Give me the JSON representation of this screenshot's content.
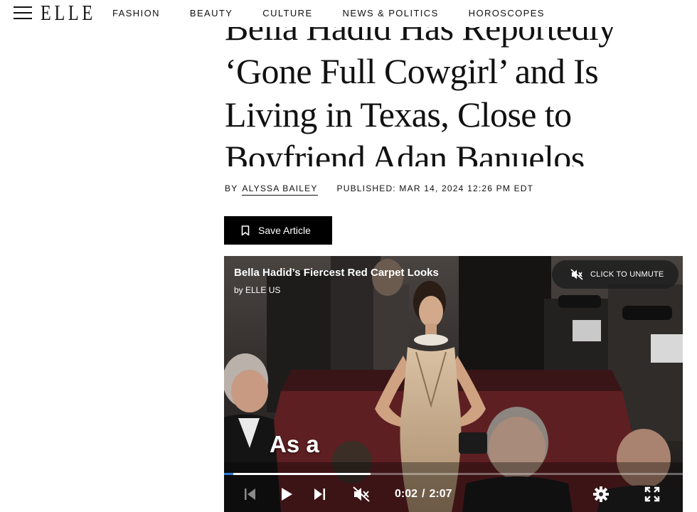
{
  "header": {
    "logo": "ELLE",
    "nav": [
      "FASHION",
      "BEAUTY",
      "CULTURE",
      "NEWS & POLITICS",
      "HOROSCOPES"
    ]
  },
  "article": {
    "headline_lines": [
      "Bella Hadid Has Reportedly",
      "‘Gone Full Cowgirl’ and Is",
      "Living in Texas, Close to",
      "Boyfriend Adan Banuelos"
    ],
    "byline_prefix": "BY",
    "author": "ALYSSA BAILEY",
    "published": "PUBLISHED: MAR 14, 2024 12:26 PM EDT",
    "save_label": "Save Article"
  },
  "video": {
    "title": "Bella Hadid’s Fiercest Red Carpet Looks",
    "by": "by ELLE US",
    "unmute_label": "CLICK TO UNMUTE",
    "caption": "As a",
    "current_time": "0:02",
    "time_separator": "/",
    "duration": "2:07",
    "buffered_fraction": 0.32,
    "played_fraction": 0.02
  },
  "colors": {
    "accent_progress": "#2d7ad6",
    "button_bg": "#000000",
    "text": "#111111"
  }
}
